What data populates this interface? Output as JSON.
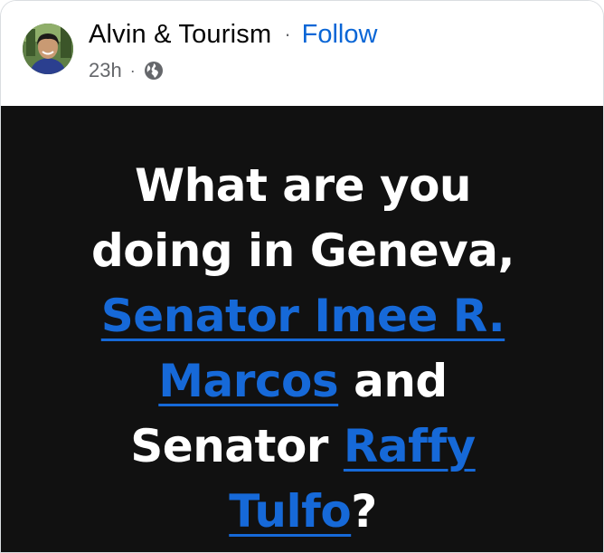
{
  "post": {
    "author": "Alvin & Tourism",
    "separator": "·",
    "follow_label": "Follow",
    "timestamp": "23h",
    "meta_separator": "·",
    "audience_icon": "globe-icon"
  },
  "image_text": {
    "line1": "What are you",
    "line2": "doing in Geneva,",
    "mention1_part1": "Senator Imee R.",
    "mention1_part2": "Marcos",
    "connector": "and",
    "prefix2": "Senator",
    "mention2_part1": "Raffy",
    "mention2_part2": "Tulfo",
    "ending": "?"
  },
  "colors": {
    "link_blue": "#0a66d6",
    "mention_blue": "#1669d8",
    "image_background": "#111111",
    "text_white": "#ffffff"
  }
}
